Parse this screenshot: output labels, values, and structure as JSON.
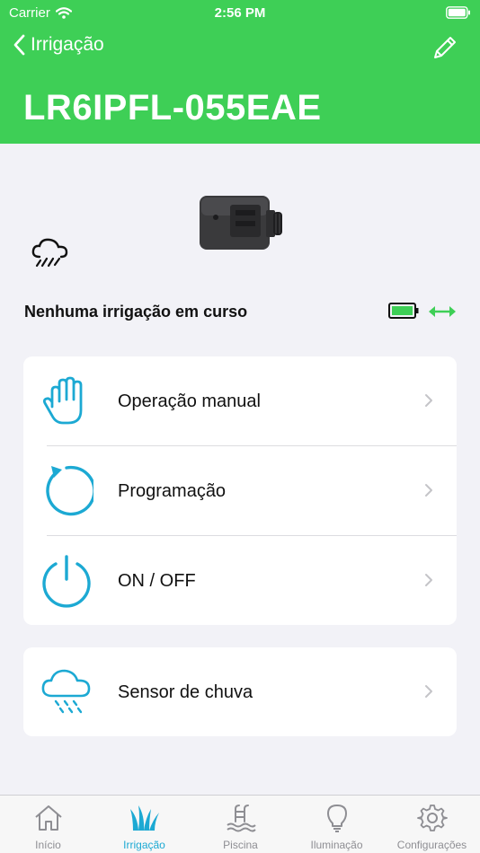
{
  "status_bar": {
    "carrier": "Carrier",
    "time": "2:56 PM"
  },
  "nav": {
    "back_label": "Irrigação"
  },
  "device": {
    "title": "LR6IPFL-055EAE",
    "status": "Nenhuma irrigação em curso"
  },
  "menu": [
    {
      "label": "Operação manual",
      "icon": "hand-icon"
    },
    {
      "label": "Programação",
      "icon": "refresh-icon"
    },
    {
      "label": "ON / OFF",
      "icon": "power-icon"
    }
  ],
  "sensor": {
    "label": "Sensor de chuva",
    "icon": "rain-cloud-icon"
  },
  "tabs": [
    {
      "label": "Início",
      "icon": "home-icon"
    },
    {
      "label": "Irrigação",
      "icon": "grass-icon",
      "active": true
    },
    {
      "label": "Piscina",
      "icon": "pool-icon"
    },
    {
      "label": "Iluminação",
      "icon": "bulb-icon"
    },
    {
      "label": "Configurações",
      "icon": "gear-icon"
    }
  ],
  "colors": {
    "header": "#3ecf56",
    "accent": "#1ca9d3",
    "connection": "#3ecf56"
  }
}
